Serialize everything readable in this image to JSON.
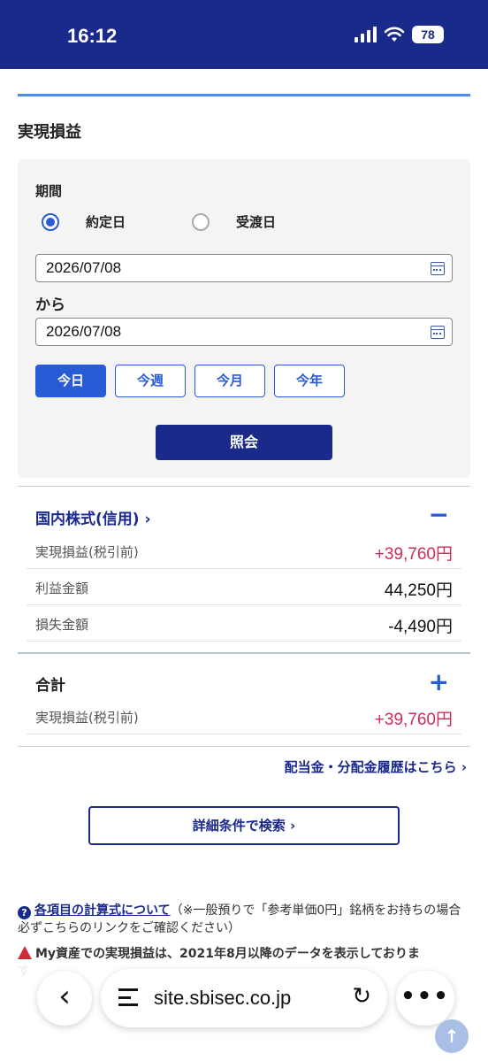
{
  "status_bar": {
    "time": "16:12",
    "battery": "78"
  },
  "section_title": "実現損益",
  "period": {
    "label": "期間",
    "options": [
      "約定日",
      "受渡日"
    ],
    "selected": "約定日",
    "from_date": "2026/07/08",
    "from_label": "から",
    "to_date": "2026/07/08",
    "quick_buttons": [
      "今日",
      "今週",
      "今月",
      "今年"
    ],
    "active_quick": "今日",
    "query_button": "照会"
  },
  "domestic": {
    "title": "国内株式(信用) ›",
    "toggle": "−",
    "rows": [
      {
        "label": "実現損益(税引前)",
        "value": "+39,760円"
      },
      {
        "label": "利益金額",
        "value": "44,250円"
      },
      {
        "label": "損失金額",
        "value": "-4,490円"
      }
    ]
  },
  "total": {
    "title": "合計",
    "toggle": "+",
    "rows": [
      {
        "label": "実現損益(税引前)",
        "value": "+39,760円"
      }
    ]
  },
  "dividend_link": "配当金・分配金履歴はこちら ›",
  "detail_button": "詳細条件で検索 ›",
  "notes": {
    "formula_link": "各項目の計算式について",
    "formula_text": "（※一般預りで「参考単価0円」銘柄をお持ちの場合必ずこちらのリンクをご確認ください）",
    "warning_text": "My資産での実現損益は、2021年8月以降のデータを表示しておりま",
    "warning_cut": "す"
  },
  "browser": {
    "url": "site.sbisec.co.jp"
  },
  "colors": {
    "brand_navy": "#1a2a8a",
    "accent_blue": "#2a5bd7",
    "profit_red": "#d12b57"
  }
}
